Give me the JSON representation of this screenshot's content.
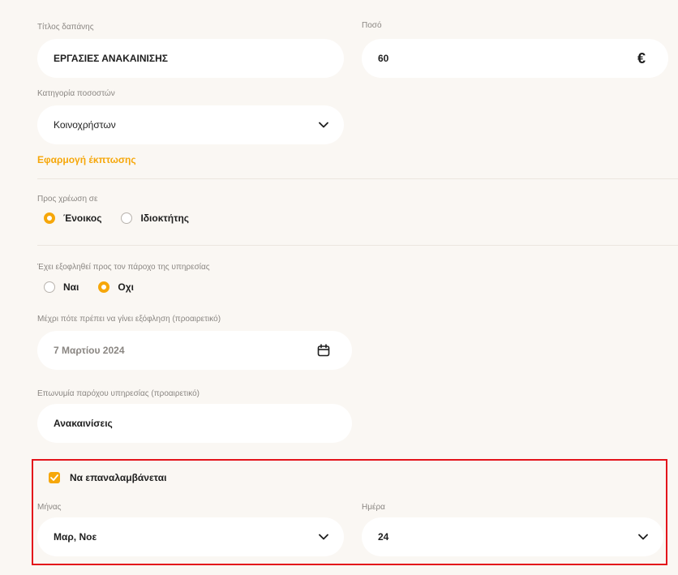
{
  "expense_title": {
    "label": "Τίτλος δαπάνης",
    "value": "ΕΡΓΑΣΙΕΣ ΑΝΑΚΑΙΝΙΣΗΣ"
  },
  "amount": {
    "label": "Ποσό",
    "value": "60",
    "currency": "€"
  },
  "percent_category": {
    "label": "Κατηγορία ποσοστών",
    "value": "Κοινοχρήστων"
  },
  "apply_discount_link": "Εφαρμογή έκπτωσης",
  "charge_to": {
    "label": "Προς χρέωση σε",
    "options": [
      "Ένοικος",
      "Ιδιοκτήτης"
    ],
    "selected": "Ένοικος"
  },
  "paid_to_provider": {
    "label": "Έχει εξοφληθεί προς τον πάροχο της υπηρεσίας",
    "options": [
      "Ναι",
      "Όχι"
    ],
    "options_display": [
      "Ναι",
      "Οχι"
    ],
    "selected": "Οχι"
  },
  "due_date": {
    "label": "Μέχρι πότε πρέπει να γίνει εξόφληση (προαιρετικό)",
    "value": "7 Μαρτίου 2024"
  },
  "provider_name": {
    "label": "Επωνυμία παρόχου υπηρεσίας (προαιρετικό)",
    "value": "Ανακαινίσεις"
  },
  "recurring": {
    "checkbox_label": "Να επαναλαμβάνεται",
    "checked": true,
    "month_label": "Μήνας",
    "month_value": "Μαρ, Νοε",
    "day_label": "Ημέρα",
    "day_value": "24"
  },
  "colors": {
    "accent": "#f6a70a",
    "highlight_border": "#e3141b",
    "background": "#faf7f3"
  }
}
